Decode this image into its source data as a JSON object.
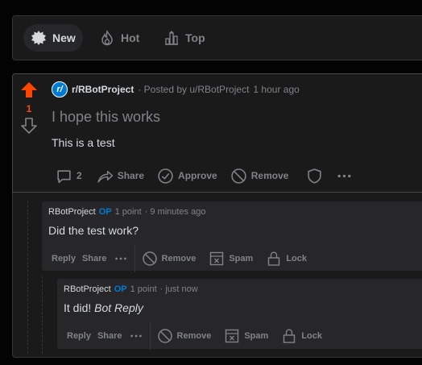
{
  "sort": {
    "new_label": "New",
    "hot_label": "Hot",
    "top_label": "Top",
    "active": "New"
  },
  "post": {
    "score": "1",
    "subreddit": "r/RBotProject",
    "posted_by": "· Posted by u/RBotProject",
    "time": "1 hour ago",
    "title": "I hope this works",
    "body": "This is a test",
    "comment_count": "2",
    "share_label": "Share",
    "approve_label": "Approve",
    "remove_label": "Remove"
  },
  "comments": [
    {
      "author": "RBotProject",
      "op": "OP",
      "points": "1 point",
      "time": "· 9 minutes ago",
      "text": "Did the test work?",
      "reply_label": "Reply",
      "share_label": "Share",
      "remove_label": "Remove",
      "spam_label": "Spam",
      "lock_label": "Lock"
    },
    {
      "author": "RBotProject",
      "op": "OP",
      "points": "1 point",
      "time": "· just now",
      "text_plain": "It did!",
      "text_italic": "Bot Reply",
      "reply_label": "Reply",
      "share_label": "Share",
      "remove_label": "Remove",
      "spam_label": "Spam",
      "lock_label": "Lock"
    }
  ],
  "colors": {
    "upvote": "#ff4500",
    "op_badge": "#0079d3",
    "background": "#030303",
    "card": "#1a1a1b"
  }
}
